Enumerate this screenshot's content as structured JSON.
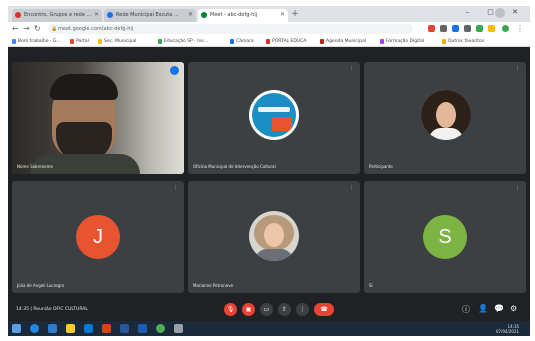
{
  "browser": {
    "tabs": [
      {
        "title": "Encontro, Grupos e rede ...",
        "active": false,
        "favicon_color": "#d93025"
      },
      {
        "title": "Rede Municipal Escuta ...",
        "active": false,
        "favicon_color": "#1a73e8"
      },
      {
        "title": "Meet - abc-defg-hij",
        "active": true,
        "favicon_color": "#00832d"
      }
    ],
    "new_tab": "+",
    "window_buttons": "– ▢ ✕",
    "url": "meet.google.com/abc-defg-hij",
    "bookmarks": [
      {
        "label": "Bom trabalho - G...",
        "color": "#4285f4"
      },
      {
        "label": "Portal",
        "color": "#ea4335"
      },
      {
        "label": "Sec. Municipal",
        "color": "#fbbc04"
      },
      {
        "label": "Educação SP - Ins...",
        "color": "#34a853"
      },
      {
        "label": "Câmara",
        "color": "#1a73e8"
      },
      {
        "label": "PORTAL EDUCA",
        "color": "#d93025"
      },
      {
        "label": "Agenda Municipal",
        "color": "#c5221f"
      },
      {
        "label": "Formação Digital",
        "color": "#a142f4"
      },
      {
        "label": "Outros favoritos",
        "color": "#f9ab00"
      }
    ]
  },
  "meet": {
    "tiles": [
      {
        "name": "Nome Sobrenome",
        "type": "video"
      },
      {
        "name": "Oficina Municipal de Intervenção Cultural",
        "type": "logo"
      },
      {
        "name": "Participante",
        "type": "photo"
      },
      {
        "name": "Júlia de Angeli Lucregro",
        "type": "letter",
        "letter": "J",
        "color": "#e8542f"
      },
      {
        "name": "Marianne Petroneve",
        "type": "photo"
      },
      {
        "name": "Si",
        "type": "letter",
        "letter": "S",
        "color": "#7cb342"
      }
    ],
    "meeting_time": "14:35",
    "meeting_title": "Reunião OFIC CULTURAL",
    "colors": {
      "end_call": "#ea4335",
      "muted": "#ea4335",
      "tile": "#3c4043",
      "bg": "#202124"
    }
  },
  "taskbar": {
    "time": "14:35",
    "date": "07/04/2021"
  }
}
